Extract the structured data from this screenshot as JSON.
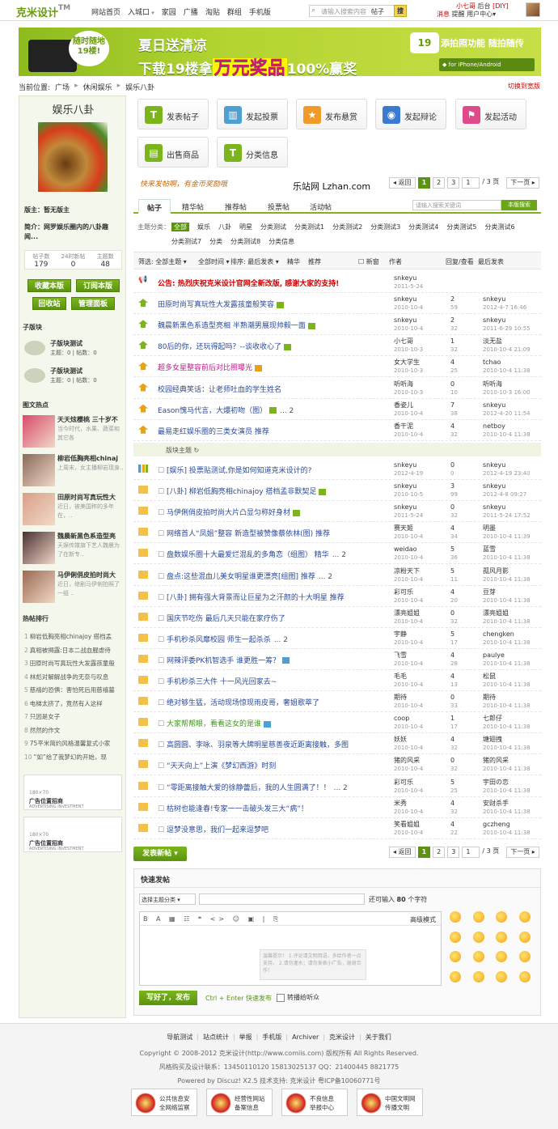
{
  "topbar": {
    "logo": "克米设计",
    "logo_tm": "TM",
    "nav": [
      "网站首页",
      "入城口",
      "家园",
      "广播",
      "淘贴",
      "群组",
      "手机版"
    ],
    "search_placeholder": "请输入搜索内容",
    "search_cat": "帖子",
    "search_btn": "搜",
    "user": "小七哥",
    "backend": "后台",
    "diy": "[DIY]",
    "msg": "消息",
    "notice": "提醒",
    "usercenter": "用户中心"
  },
  "banner": {
    "bubble": "随时随地19楼!",
    "line1": "夏日送清凉",
    "line2a": "下载19楼拿",
    "line2b": "万元奖品",
    "line2c": "100%赢奖",
    "app": "19",
    "slogan": "添拍照功能 随拍随传",
    "os": "for iPhone/Android"
  },
  "breadcrumb": {
    "label": "当前位置:",
    "items": [
      "广场",
      "休闲娱乐",
      "娱乐八卦"
    ],
    "switch": "切换到宽版"
  },
  "left": {
    "forum_name": "娱乐八卦",
    "moderator_label": "版主：",
    "moderator": "暂无版主",
    "intro_label": "简介：",
    "intro": "网罗娱乐圈内的八卦趣闻...",
    "stats": [
      {
        "label": "帖子数",
        "value": "179"
      },
      {
        "label": "24时新帖",
        "value": "0"
      },
      {
        "label": "主题数",
        "value": "48"
      }
    ],
    "buttons": [
      "收藏本版",
      "订阅本版",
      "回收站",
      "管理面板"
    ],
    "sub_title": "子版块",
    "subforums": [
      {
        "name": "子版块测试",
        "meta": "主题：0 | 帖数：0"
      },
      {
        "name": "子版块测试",
        "meta": "主题：0 | 帖数：0"
      }
    ],
    "pic_title": "图文热点",
    "pics": [
      {
        "t": "天天炫樱桃 三十岁不",
        "d": "当今时代，水果、蔬菜和其它各",
        "c": "#d94a6a"
      },
      {
        "t": "柳岩低胸亮相chinaj",
        "d": "上周末，女主播柳岩现身..",
        "c": "#8a6a5a"
      },
      {
        "t": "田原时尚写真玩性大",
        "d": "近日，被美国称的多年在，..",
        "c": "#d8a088"
      },
      {
        "t": "魏晨新黑色系造型亮",
        "d": "天娱传媒旗下艺人魏晨为了在新专..",
        "c": "#4a3030"
      },
      {
        "t": "马伊俐俏皮拍时尚大",
        "d": "近日，继剧马伊俐拍照了一组 ..",
        "c": "#9a6a50"
      }
    ],
    "hot_title": "热帖排行",
    "hot": [
      "柳岩低胸亮相chinajoy 搭档孟",
      "真相被揭露:日本二战血腥虐待",
      "田原时尚写真玩性大发露孩童般",
      "林彪对解解战争的无奈与叹息",
      "慈禧的恐惧：害怕死后用慈禧墓",
      "电梯太挤了，竟然有人这样",
      "只因是女子",
      "然然的作文",
      "75平米简约风格温馨复式小家",
      "“如”给了我梦幻的开始，现"
    ],
    "ads": [
      {
        "size": "180×70",
        "title": "广告位置招商",
        "en": "ADVERTISING INVESTMENT"
      },
      {
        "size": "180×70",
        "title": "广告位置招商",
        "en": "ADVERTISING INVESTMENT"
      }
    ]
  },
  "actions": [
    {
      "label": "发表帖子",
      "icon": "T",
      "color": "#7bb51b"
    },
    {
      "label": "发起投票",
      "icon": "▥",
      "color": "#4da0d0"
    },
    {
      "label": "发布悬赏",
      "icon": "★",
      "color": "#f09a2a"
    },
    {
      "label": "发起辩论",
      "icon": "◉",
      "color": "#3a7ad0"
    },
    {
      "label": "发起活动",
      "icon": "⚑",
      "color": "#e04a8a"
    },
    {
      "label": "出售商品",
      "icon": "▤",
      "color": "#7bb51b"
    },
    {
      "label": "分类信息",
      "icon": "T",
      "color": "#7bb51b"
    }
  ],
  "slogan": "快来发帖啊，有金币奖励哦",
  "lzhan": "乐站网 Lzhan.com",
  "pager": {
    "prev": "◂ 返回",
    "pages": [
      "1",
      "2",
      "3"
    ],
    "goto": "1",
    "total": "/ 3 页",
    "next": "下一页 ▸"
  },
  "tabs": [
    "帖子",
    "精华帖",
    "推荐帖",
    "投票帖",
    "活动帖"
  ],
  "forum_search": {
    "placeholder": "请输入搜索关键词",
    "btn": "本版搜索"
  },
  "types": {
    "label": "主题分类：",
    "items": [
      "全部",
      "娱乐",
      "八卦",
      "明星",
      "分类测试",
      "分类测试1",
      "分类测试2",
      "分类测试3",
      "分类测试4",
      "分类测试5",
      "分类测试6",
      "分类测试7",
      "分类",
      "分类测试8",
      "分类信息"
    ]
  },
  "filter": {
    "f1": "筛选: 全部主题 ▾",
    "f2": "全部时间 ▾",
    "f3": "排序: 最后发表 ▾",
    "f4": "精华",
    "f5": "推荐",
    "newwin": "新窗",
    "author": "作者",
    "reply": "回复/查看",
    "last": "最后发表"
  },
  "separator": "版块主题 ↻",
  "threads": [
    {
      "type": "ann",
      "title": "公告: 热烈庆祝克米设计官网全新改版, 感谢大家的支持!",
      "author": "snkeyu",
      "adate": "2011-5-24",
      "r": "",
      "v": "",
      "lu": "",
      "ld": ""
    },
    {
      "type": "top",
      "title": "田原时尚写真玩性大发露孩童般笑容",
      "mk": "g",
      "author": "snkeyu",
      "adate": "2010-10-4",
      "r": "2",
      "v": "59",
      "lu": "snkeyu",
      "ld": "2012-4-7 16:46"
    },
    {
      "type": "top",
      "title": "魏晨新黑色系造型亮相 半熟潮男展现帅毅一面",
      "mk": "g",
      "author": "snkeyu",
      "adate": "2010-10-4",
      "r": "2",
      "v": "32",
      "lu": "snkeyu",
      "ld": "2011-6-29 10:55"
    },
    {
      "type": "top",
      "title": "80后的你，还玩得起吗？--谈收收心了",
      "mk": "g",
      "author": "小七哥",
      "adate": "2010-10-3",
      "r": "1",
      "v": "32",
      "lu": "淡无盐",
      "ld": "2010-10-4 21:09"
    },
    {
      "type": "top",
      "title": "超多女星整容前后对比照曝光",
      "mk": "o",
      "author": "女大学生",
      "adate": "2010-10-3",
      "r": "4",
      "v": "25",
      "lu": "tchao",
      "ld": "2010-10-4 11:38"
    },
    {
      "type": "top",
      "title": "校园经典笑话：让老师吐血的学生姓名",
      "author": "听听海",
      "adate": "2010-10-3",
      "r": "0",
      "v": "10",
      "lu": "听听海",
      "ld": "2010-10-3 16:00"
    },
    {
      "type": "top",
      "title": "Eason愧马代言，大爆初吻（图）",
      "mk": "g",
      "pg": "... 2",
      "author": "香姿儿",
      "adate": "2010-10-4",
      "r": "7",
      "v": "38",
      "lu": "snkeyu",
      "ld": "2012-4-20 11:54"
    },
    {
      "type": "top",
      "title": "最易走红娱乐圈的三类女演员 推荐",
      "author": "香干泥",
      "adate": "2010-10-4",
      "r": "4",
      "v": "32",
      "lu": "netboy",
      "ld": "2010-10-4 11:38"
    },
    {
      "type": "vote",
      "title": "[娱乐] 投票贴测试,你是如何知道克米设计的?",
      "author": "snkeyu",
      "adate": "2012-4-19",
      "r": "0",
      "v": "0",
      "lu": "snkeyu",
      "ld": "2012-4-19 23:40"
    },
    {
      "type": "f",
      "title": "[八卦] 柳岩低胸亮相chinajoy 搭档孟非默契足",
      "mk": "g",
      "author": "snkeyu",
      "adate": "2010-10-5",
      "r": "3",
      "v": "99",
      "lu": "snkeyu",
      "ld": "2012-4-8 09:27"
    },
    {
      "type": "f",
      "title": "马伊俐俏皮拍时尚大片凸显匀称好身材",
      "mk": "g",
      "author": "snkeyu",
      "adate": "2011-5-24",
      "r": "0",
      "v": "32",
      "lu": "snkeyu",
      "ld": "2011-5-24 17:52"
    },
    {
      "type": "f",
      "title": "网络首人“凤姐”整容 新造型被赞像蔡依林(图) 推荐",
      "author": "赛天姬",
      "adate": "2010-10-4",
      "r": "4",
      "v": "34",
      "lu": "明墨",
      "ld": "2010-10-4 11:39"
    },
    {
      "type": "f",
      "title": "盘数娱乐圈十大最爱烂混乱的多角恋（组图） 精华",
      "pg": "... 2",
      "author": "weidao",
      "adate": "2010-10-4",
      "r": "5",
      "v": "36",
      "lu": "蓝雪",
      "ld": "2010-10-4 11:38"
    },
    {
      "type": "f",
      "title": "盘点:这些混血儿美女明星谁更漂亮[组图] 推荐",
      "pg": "... 2",
      "author": "凉粉天下",
      "adate": "2010-10-4",
      "r": "5",
      "v": "11",
      "lu": "孤风月影",
      "ld": "2010-10-4 11:38"
    },
    {
      "type": "f",
      "title": "[八卦] 拥有强大背景而让巨星为之汗颜的十大明星 推荐",
      "author": "彩可乐",
      "adate": "2010-10-4",
      "r": "4",
      "v": "20",
      "lu": "豆芽",
      "ld": "2010-10-4 11:38"
    },
    {
      "type": "f",
      "title": "国庆节吃伤 最后几天只能在家疗伤了",
      "author": "漂亮姐姐",
      "adate": "2010-10-4",
      "r": "0",
      "v": "32",
      "lu": "漂亮姐姐",
      "ld": "2010-10-4 11:38"
    },
    {
      "type": "f",
      "title": "手机秒杀风靡校园 师生一起杀杀",
      "pg": "... 2",
      "author": "宇静",
      "adate": "2010-10-4",
      "r": "5",
      "v": "17",
      "lu": "chengken",
      "ld": "2010-10-4 11:38"
    },
    {
      "type": "f",
      "title": "网辣评委PK机智选手 谁更胜一筹？",
      "mk": "b",
      "author": "飞雪",
      "adate": "2010-10-4",
      "r": "4",
      "v": "28",
      "lu": "paulye",
      "ld": "2010-10-4 11:38"
    },
    {
      "type": "f",
      "title": "手机秒杀三大件 十一风光回家去~",
      "author": "毛毛",
      "adate": "2010-10-4",
      "r": "4",
      "v": "13",
      "lu": "松鼠",
      "ld": "2010-10-4 11:38"
    },
    {
      "type": "f",
      "title": "绝对够生猛，活动现场惊现雨皮哥，奢姐歌萃了",
      "author": "期待",
      "adate": "2010-10-4",
      "r": "0",
      "v": "33",
      "lu": "期待",
      "ld": "2010-10-4 11:38"
    },
    {
      "type": "f",
      "title": "大家帮帮眼，看看这女的是谁",
      "mk": "b",
      "green": true,
      "author": "coop",
      "adate": "2010-10-4",
      "r": "1",
      "v": "17",
      "lu": "七郎仔",
      "ld": "2010-10-4 11:38"
    },
    {
      "type": "f",
      "title": "高圆圆、李咏、羽泉等大牌明星慈善夜近距离接触，多图",
      "author": "妖妖",
      "adate": "2010-10-4",
      "r": "4",
      "v": "32",
      "lu": "塘翅拽",
      "ld": "2010-10-4 11:38"
    },
    {
      "type": "f",
      "title": "“天天向上”上演《梦幻西游》时刻",
      "author": "猪的风采",
      "adate": "2010-10-4",
      "r": "0",
      "v": "32",
      "lu": "猪的风采",
      "ld": "2010-10-4 11:38"
    },
    {
      "type": "f",
      "title": "“零距离接触大爱的徐静蕾后，我的人生圆满了！！",
      "pg": "... 2",
      "author": "彩可乐",
      "adate": "2010-10-4",
      "r": "5",
      "v": "25",
      "lu": "宇田の恋",
      "ld": "2010-10-4 11:38"
    },
    {
      "type": "f",
      "title": "枯树也能逢春!专家一一击破头发三大“病”！",
      "author": "米秀",
      "adate": "2010-10-4",
      "r": "4",
      "v": "32",
      "lu": "安财杀手",
      "ld": "2010-10-4 11:38"
    },
    {
      "type": "f",
      "title": "逗梦没意思，我们一起来逗梦吧",
      "author": "笑看姐姐",
      "adate": "2010-10-4",
      "r": "4",
      "v": "22",
      "lu": "gczheng",
      "ld": "2010-10-4 11:38"
    }
  ],
  "newpost": "发表新帖 ▾",
  "quick": {
    "title": "快速发帖",
    "select": "选择主题分类 ▾",
    "count_pre": "还可输入",
    "count": "80",
    "count_post": "个字符",
    "toolbar": "B A ▦ ☷ ❝ <> ☺ ▣ | ⎘",
    "mode": "高级模式",
    "tip": "温馨提示！ 1.评论请文明用语，多给作者一点支持。 2.请勿灌水；请勿发表小广告，谢谢合作！",
    "submit": "写好了，发布",
    "ctrl": "Ctrl + Enter 快速发布",
    "chk": "转播给听众"
  },
  "footer": {
    "links": [
      "导航测试",
      "站点统计",
      "举报",
      "手机版",
      "Archiver",
      "克米设计",
      "关于我们"
    ],
    "copyright": "Copyright © 2008-2012 克米设计(http://www.comiis.com) 版权所有 All Rights Reserved.",
    "contact": "风格购买及设计联系：13450110120 15813025137 QQ：21400445 8821775",
    "powered": "Powered by Discuz! X2.5  技术支持: 克米设计 粤ICP备10060771号",
    "badges": [
      {
        "t1": "公共信息安",
        "t2": "全网络监察"
      },
      {
        "t1": "经营性网站",
        "t2": "备案信息"
      },
      {
        "t1": "不良信息",
        "t2": "举报中心"
      },
      {
        "t1": "中国文明网",
        "t2": "传播文明"
      }
    ]
  }
}
